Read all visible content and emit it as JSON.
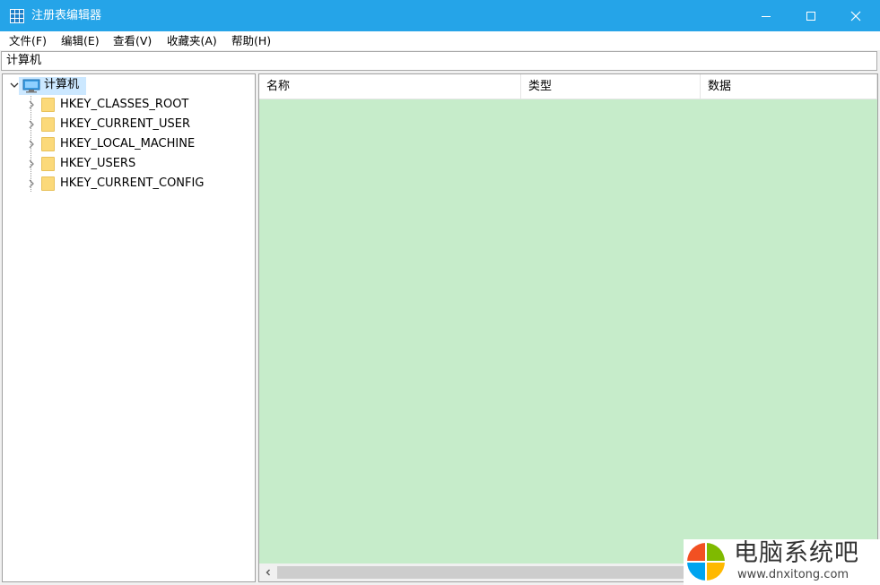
{
  "window": {
    "title": "注册表编辑器",
    "icon": "registry-editor-icon",
    "controls": [
      "minimize-icon",
      "maximize-icon",
      "close-icon"
    ]
  },
  "menu": {
    "items": [
      "文件(F)",
      "编辑(E)",
      "查看(V)",
      "收藏夹(A)",
      "帮助(H)"
    ]
  },
  "address": {
    "path": "计算机"
  },
  "tree": {
    "root": {
      "label": "计算机",
      "icon": "computer-icon",
      "expanded": true,
      "selected": true
    },
    "children": [
      {
        "label": "HKEY_CLASSES_ROOT",
        "icon": "folder-icon"
      },
      {
        "label": "HKEY_CURRENT_USER",
        "icon": "folder-icon"
      },
      {
        "label": "HKEY_LOCAL_MACHINE",
        "icon": "folder-icon"
      },
      {
        "label": "HKEY_USERS",
        "icon": "folder-icon"
      },
      {
        "label": "HKEY_CURRENT_CONFIG",
        "icon": "folder-icon"
      }
    ]
  },
  "list": {
    "columns": [
      "名称",
      "类型",
      "数据"
    ],
    "rows": [],
    "background": "#c6ecca"
  },
  "watermark": {
    "title": "电脑系统吧",
    "url": "www.dnxitong.com"
  },
  "colors": {
    "titlebar": "#25a4e8",
    "selection": "#cce8ff",
    "folder": "#fbd97a"
  }
}
